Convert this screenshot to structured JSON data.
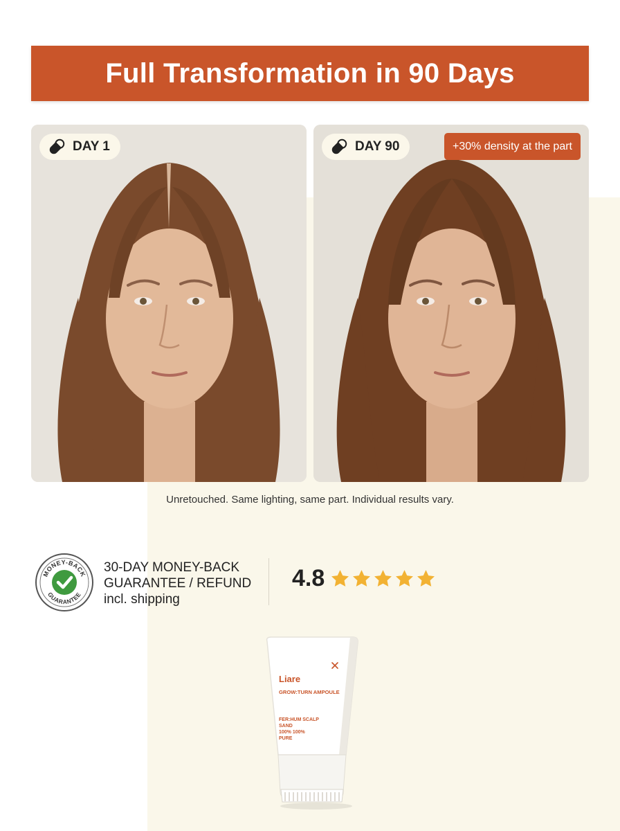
{
  "header": {
    "title": "Full Transformation in 90 Days"
  },
  "comparison": {
    "before": {
      "label": "DAY 1"
    },
    "after": {
      "label": "DAY 90",
      "badge": "+30% density at the part"
    }
  },
  "disclaimer": "Unretouched. Same lighting, same part. Individual results vary.",
  "guarantee": {
    "seal_text": "MONEY-BACK GUARANTEE",
    "line1": "30-DAY MONEY-BACK",
    "line2": "GUARANTEE / REFUND",
    "line3": "incl. shipping"
  },
  "rating": {
    "value": "4.8",
    "stars": 5
  },
  "product": {
    "brand": "Liare",
    "name": "GROW:TURN AMPOULE",
    "desc_line1": "FER:HUM SCALP",
    "desc_line2": "SAND",
    "desc_line3": "100% 100%",
    "desc_line4": "PURE"
  },
  "colors": {
    "accent": "#c9552a",
    "cream": "#faf7ea",
    "star": "#f2b233",
    "check_green": "#3f9a3f"
  },
  "icons": {
    "day_pill": "capsule-icon",
    "rating": "star-icon",
    "seal": "check-icon"
  }
}
